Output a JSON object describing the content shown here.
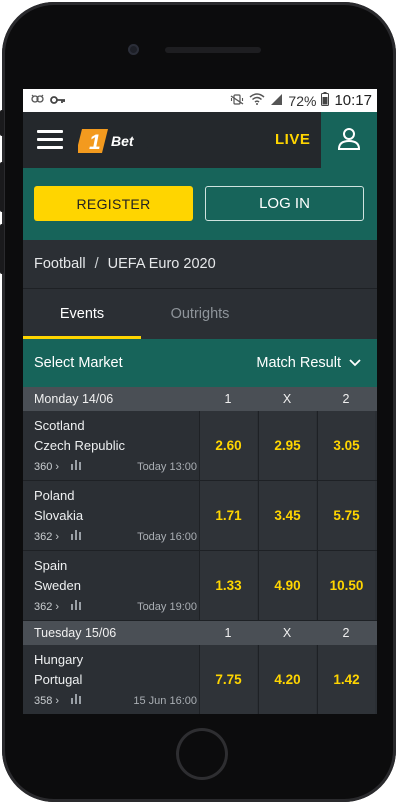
{
  "statusbar": {
    "battery": "72%",
    "time": "10:17"
  },
  "header": {
    "logo_number": "1",
    "logo_text": "Bet",
    "live_label": "LIVE"
  },
  "auth": {
    "register_label": "REGISTER",
    "login_label": "LOG IN"
  },
  "breadcrumb": {
    "sport": "Football",
    "separator": "/",
    "competition": "UEFA Euro 2020"
  },
  "tabs": [
    {
      "label": "Events"
    },
    {
      "label": "Outrights"
    }
  ],
  "market": {
    "label": "Select Market",
    "selected": "Match Result"
  },
  "columns": [
    "1",
    "X",
    "2"
  ],
  "days": [
    {
      "label": "Monday 14/06",
      "matches": [
        {
          "home": "Scotland",
          "away": "Czech Republic",
          "markets": "360",
          "time": "Today  13:00",
          "odds": [
            "2.60",
            "2.95",
            "3.05"
          ]
        },
        {
          "home": "Poland",
          "away": "Slovakia",
          "markets": "362",
          "time": "Today  16:00",
          "odds": [
            "1.71",
            "3.45",
            "5.75"
          ]
        },
        {
          "home": "Spain",
          "away": "Sweden",
          "markets": "362",
          "time": "Today  19:00",
          "odds": [
            "1.33",
            "4.90",
            "10.50"
          ]
        }
      ]
    },
    {
      "label": "Tuesday 15/06",
      "matches": [
        {
          "home": "Hungary",
          "away": "Portugal",
          "markets": "358",
          "time": "15 Jun  16:00",
          "odds": [
            "7.75",
            "4.20",
            "1.42"
          ]
        }
      ]
    }
  ],
  "colors": {
    "accent_yellow": "#ffd500",
    "brand_green": "#17645a",
    "logo_orange": "#f39a1e",
    "background": "#2b2f34"
  }
}
